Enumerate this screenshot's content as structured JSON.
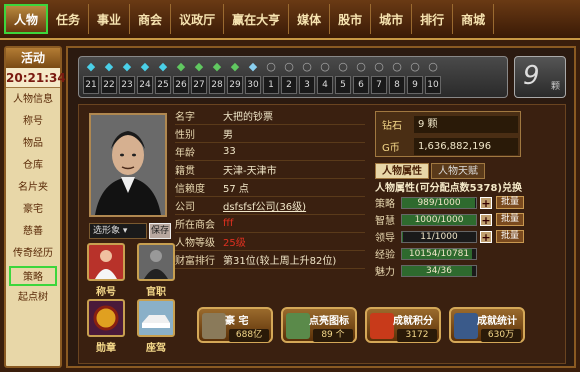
{
  "nav": {
    "tabs": [
      "人物",
      "任务",
      "事业",
      "商会",
      "议政厅",
      "赢在大亨",
      "媒体",
      "股市",
      "城市",
      "排行",
      "商城"
    ]
  },
  "sidebar": {
    "header": "活动",
    "clock": "20:21:34",
    "items": [
      "人物信息",
      "称号",
      "物品",
      "仓库",
      "名片夹",
      "豪宅",
      "慈善",
      "传奇经历",
      "策略",
      "起点树"
    ]
  },
  "gems": {
    "numbers": [
      "21",
      "22",
      "23",
      "24",
      "25",
      "26",
      "27",
      "28",
      "29",
      "30",
      "1",
      "2",
      "3",
      "4",
      "5",
      "6",
      "7",
      "8",
      "9",
      "10"
    ],
    "count": "9",
    "unit": "颗"
  },
  "profile": {
    "image_select": "选形象",
    "save_label": "保存",
    "badges": [
      "称号",
      "官职",
      "勋章",
      "座驾"
    ]
  },
  "info": {
    "rows": [
      {
        "label": "名字",
        "value": "大把的钞票"
      },
      {
        "label": "性别",
        "value": "男"
      },
      {
        "label": "年龄",
        "value": "33"
      },
      {
        "label": "籍贯",
        "value": "天津-天津市"
      },
      {
        "label": "信赖度",
        "value": "57 点"
      },
      {
        "label": "公司",
        "value": "dsfsfsf公司(36级)"
      },
      {
        "label": "所在商会",
        "value": "fff"
      },
      {
        "label": "人物等级",
        "value": "25级"
      },
      {
        "label": "财富排行",
        "value": "第31位(较上周上升82位)"
      }
    ]
  },
  "money": {
    "diamond_label": "钻石",
    "diamond_value": "9 颗",
    "gcoin_label": "G币",
    "gcoin_value": "1,636,882,196"
  },
  "attributes": {
    "tab_attr": "人物属性",
    "tab_talent": "人物天赋",
    "header": "人物属性(可分配点数5378)兑换",
    "batch_label": "批量",
    "rows": [
      {
        "label": "策略",
        "text": "989/1000",
        "fill": 0.989,
        "plus": true
      },
      {
        "label": "智慧",
        "text": "1000/1000",
        "fill": 1.0,
        "plus": true
      },
      {
        "label": "领导",
        "text": "11/1000",
        "fill": 0.011,
        "plus": true
      },
      {
        "label": "经验",
        "text": "10154/10781",
        "fill": 0.942,
        "plus": false
      },
      {
        "label": "魅力",
        "text": "34/36",
        "fill": 0.944,
        "plus": false
      }
    ]
  },
  "bottom": [
    {
      "title": "豪 宅",
      "value": "688亿"
    },
    {
      "title": "点亮图标",
      "value": "89 个"
    },
    {
      "title": "成就积分",
      "value": "3172"
    },
    {
      "title": "成就统计",
      "value": "630万"
    }
  ]
}
